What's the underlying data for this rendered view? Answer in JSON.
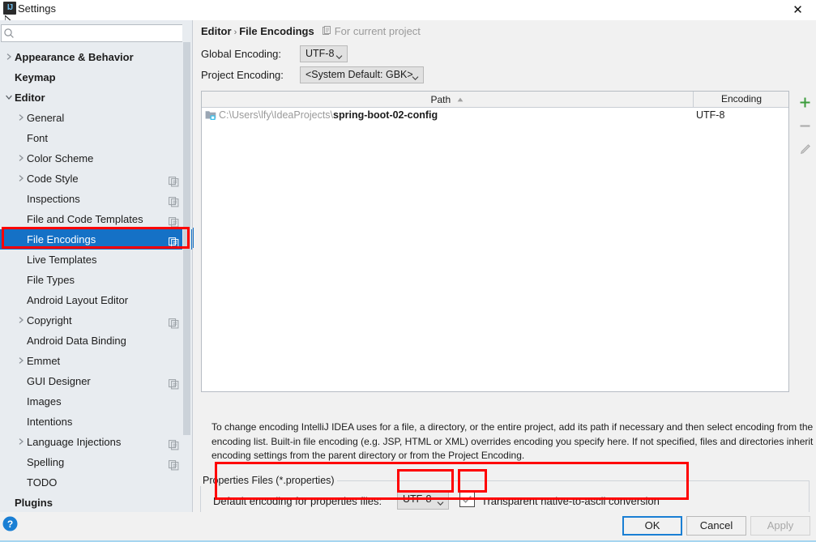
{
  "window": {
    "title": "Settings",
    "app_icon": "intellij-idea-icon",
    "close_label": "✕"
  },
  "sidebar": {
    "search": {
      "placeholder": "",
      "value": "",
      "icon": "search-icon"
    },
    "items": [
      {
        "label": "Appearance & Behavior",
        "level": 0,
        "arrow": "collapsed",
        "copy": false,
        "selected": false
      },
      {
        "label": "Keymap",
        "level": 0,
        "arrow": "none",
        "copy": false,
        "selected": false
      },
      {
        "label": "Editor",
        "level": 0,
        "arrow": "expanded",
        "copy": false,
        "selected": false
      },
      {
        "label": "General",
        "level": 1,
        "arrow": "collapsed",
        "copy": false,
        "selected": false
      },
      {
        "label": "Font",
        "level": 1,
        "arrow": "none",
        "copy": false,
        "selected": false
      },
      {
        "label": "Color Scheme",
        "level": 1,
        "arrow": "collapsed",
        "copy": false,
        "selected": false
      },
      {
        "label": "Code Style",
        "level": 1,
        "arrow": "collapsed",
        "copy": true,
        "selected": false
      },
      {
        "label": "Inspections",
        "level": 1,
        "arrow": "none",
        "copy": true,
        "selected": false
      },
      {
        "label": "File and Code Templates",
        "level": 1,
        "arrow": "none",
        "copy": true,
        "selected": false
      },
      {
        "label": "File Encodings",
        "level": 1,
        "arrow": "none",
        "copy": true,
        "selected": true
      },
      {
        "label": "Live Templates",
        "level": 1,
        "arrow": "none",
        "copy": false,
        "selected": false
      },
      {
        "label": "File Types",
        "level": 1,
        "arrow": "none",
        "copy": false,
        "selected": false
      },
      {
        "label": "Android Layout Editor",
        "level": 1,
        "arrow": "none",
        "copy": false,
        "selected": false
      },
      {
        "label": "Copyright",
        "level": 1,
        "arrow": "collapsed",
        "copy": true,
        "selected": false
      },
      {
        "label": "Android Data Binding",
        "level": 1,
        "arrow": "none",
        "copy": false,
        "selected": false
      },
      {
        "label": "Emmet",
        "level": 1,
        "arrow": "collapsed",
        "copy": false,
        "selected": false
      },
      {
        "label": "GUI Designer",
        "level": 1,
        "arrow": "none",
        "copy": true,
        "selected": false
      },
      {
        "label": "Images",
        "level": 1,
        "arrow": "none",
        "copy": false,
        "selected": false
      },
      {
        "label": "Intentions",
        "level": 1,
        "arrow": "none",
        "copy": false,
        "selected": false
      },
      {
        "label": "Language Injections",
        "level": 1,
        "arrow": "collapsed",
        "copy": true,
        "selected": false
      },
      {
        "label": "Spelling",
        "level": 1,
        "arrow": "none",
        "copy": true,
        "selected": false
      },
      {
        "label": "TODO",
        "level": 1,
        "arrow": "none",
        "copy": false,
        "selected": false
      },
      {
        "label": "Plugins",
        "level": 0,
        "arrow": "none",
        "copy": false,
        "selected": false
      }
    ]
  },
  "main": {
    "breadcrumb": {
      "parent": "Editor",
      "separator": "›",
      "current": "File Encodings",
      "scope_icon": "project-scope-icon",
      "scope_text": "For current project"
    },
    "global_encoding": {
      "label": "Global Encoding:",
      "value": "UTF-8"
    },
    "project_encoding": {
      "label": "Project Encoding:",
      "value": "<System Default: GBK>"
    },
    "table": {
      "columns": [
        "Path",
        "Encoding"
      ],
      "sort_column": "Path",
      "sort_direction": "asc",
      "rows": [
        {
          "icon": "project-folder-icon",
          "path_prefix": "C:\\Users\\lfy\\IdeaProjects\\",
          "path_name": "spring-boot-02-config",
          "encoding": "UTF-8"
        }
      ],
      "tools": [
        {
          "name": "add-row-button",
          "glyph": "+",
          "color": "#3c9c3c"
        },
        {
          "name": "remove-row-button",
          "glyph": "−",
          "color": "#a9a9a9"
        },
        {
          "name": "edit-row-button",
          "glyph": "pencil",
          "color": "#a9a9a9"
        }
      ]
    },
    "description": "To change encoding IntelliJ IDEA uses for a file, a directory, or the entire project, add its path if necessary and then select encoding from the encoding list. Built-in file encoding (e.g. JSP, HTML or XML) overrides encoding you specify here. If not specified, files and directories inherit encoding settings from the parent directory or from the Project Encoding.",
    "properties_group": {
      "legend": "Properties Files (*.properties)",
      "default_encoding_label": "Default encoding for properties files:",
      "default_encoding_value": "UTF-8",
      "native_to_ascii_label": "Transparent native-to-ascii conversion",
      "native_to_ascii_checked": true
    }
  },
  "footer": {
    "help_label": "?",
    "ok_label": "OK",
    "cancel_label": "Cancel",
    "apply_label": "Apply"
  },
  "colors": {
    "selection_blue": "#1571c6",
    "annotation_red": "#ff0000",
    "primary_button_border": "#1a7fd4",
    "add_green": "#3c9c3c"
  }
}
